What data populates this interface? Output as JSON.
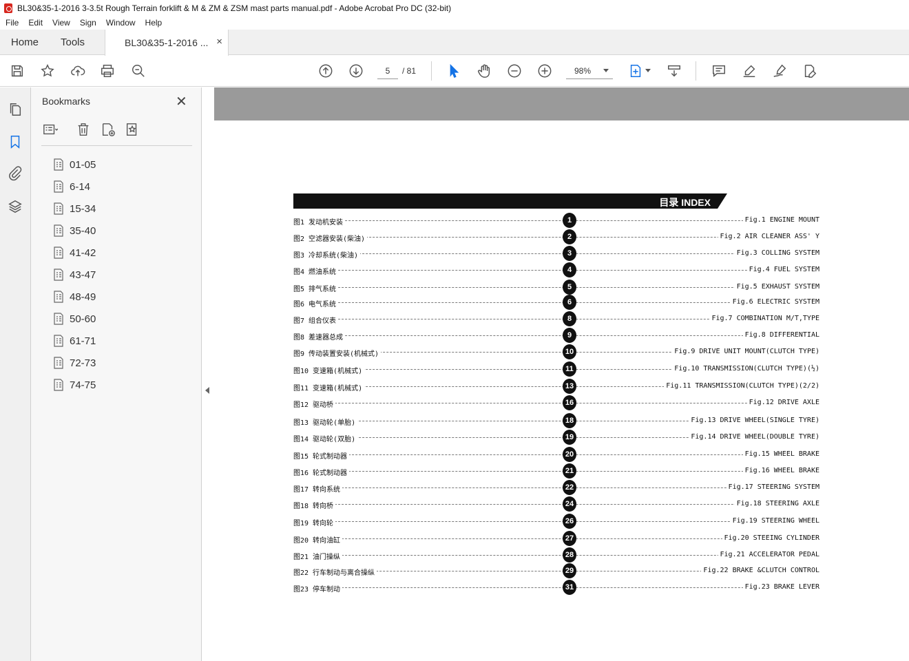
{
  "window": {
    "title": "BL30&35-1-2016 3-3.5t Rough Terrain forklift & M & ZM & ZSM mast parts manual.pdf - Adobe Acrobat Pro DC (32-bit)"
  },
  "menu": [
    "File",
    "Edit",
    "View",
    "Sign",
    "Window",
    "Help"
  ],
  "tabs": {
    "home": "Home",
    "tools": "Tools",
    "document": "BL30&35-1-2016 ...",
    "close": "×"
  },
  "toolbar": {
    "current_page": "5",
    "total_pages": "/ 81",
    "zoom": "98%"
  },
  "bookmarks": {
    "title": "Bookmarks",
    "close": "✕",
    "items": [
      "01-05",
      "6-14",
      "15-34",
      "35-40",
      "41-42",
      "43-47",
      "48-49",
      "50-60",
      "61-71",
      "72-73",
      "74-75"
    ]
  },
  "document": {
    "index_title": "目录 INDEX",
    "entries": [
      {
        "cn": "图1  发动机安装",
        "num": "1",
        "en": "Fig.1 ENGINE MOUNT"
      },
      {
        "cn": "图2  空滤器安装(柴油)",
        "num": "2",
        "en": "Fig.2 AIR CLEANER ASS' Y"
      },
      {
        "cn": "图3  冷却系统(柴油)",
        "num": "3",
        "en": "Fig.3 COLLING SYSTEM"
      },
      {
        "cn": "图4  燃油系统",
        "num": "4",
        "en": "Fig.4 FUEL SYSTEM"
      },
      {
        "cn": "图5  排气系统",
        "num": "5",
        "en": "Fig.5 EXHAUST SYSTEM"
      },
      {
        "cn": "图6  电气系统",
        "num": "6",
        "en": "Fig.6 ELECTRIC SYSTEM"
      },
      {
        "cn": "图7  组合仪表",
        "num": "8",
        "en": "Fig.7 COMBINATION M/T,TYPE"
      },
      {
        "cn": "图8  差速器总成",
        "num": "9",
        "en": "Fig.8 DIFFERENTIAL"
      },
      {
        "cn": "图9  传动装置安装(机械式)",
        "num": "10",
        "en": "Fig.9 DRIVE UNIT MOUNT(CLUTCH TYPE)"
      },
      {
        "cn": "图10  变速箱(机械式)",
        "num": "11",
        "en": "Fig.10 TRANSMISSION(CLUTCH TYPE)(½)"
      },
      {
        "cn": "图11  变速箱(机械式)",
        "num": "13",
        "en": "Fig.11 TRANSMISSION(CLUTCH TYPE)(2/2)"
      },
      {
        "cn": "图12  驱动桥",
        "num": "16",
        "en": "Fig.12 DRIVE AXLE"
      },
      {
        "cn": "图13  驱动轮(单胎)",
        "num": "18",
        "en": "Fig.13 DRIVE WHEEL(SINGLE TYRE)"
      },
      {
        "cn": "图14  驱动轮(双胎)",
        "num": "19",
        "en": "Fig.14 DRIVE WHEEL(DOUBLE TYRE)"
      },
      {
        "cn": "图15  轮式制动器",
        "num": "20",
        "en": "Fig.15 WHEEL BRAKE"
      },
      {
        "cn": "图16  轮式制动器",
        "num": "21",
        "en": "Fig.16 WHEEL BRAKE"
      },
      {
        "cn": "图17  转向系统",
        "num": "22",
        "en": "Fig.17 STEERING SYSTEM"
      },
      {
        "cn": "图18  转向桥",
        "num": "24",
        "en": "Fig.18 STEERING AXLE"
      },
      {
        "cn": "图19  转向轮",
        "num": "26",
        "en": "Fig.19 STEERING WHEEL"
      },
      {
        "cn": "图20  转向油缸",
        "num": "27",
        "en": "Fig.20 STEEING CYLINDER"
      },
      {
        "cn": "图21  油门操纵",
        "num": "28",
        "en": "Fig.21 ACCELERATOR PEDAL"
      },
      {
        "cn": "图22  行车制动与离合操纵",
        "num": "29",
        "en": "Fig.22 BRAKE &CLUTCH CONTROL"
      },
      {
        "cn": "图23  停车制动",
        "num": "31",
        "en": "Fig.23 BRAKE LEVER"
      }
    ]
  },
  "colors": {
    "accent_blue": "#1473e6",
    "acrobat_red": "#d7261e",
    "page_gray": "#9a9a9a"
  }
}
